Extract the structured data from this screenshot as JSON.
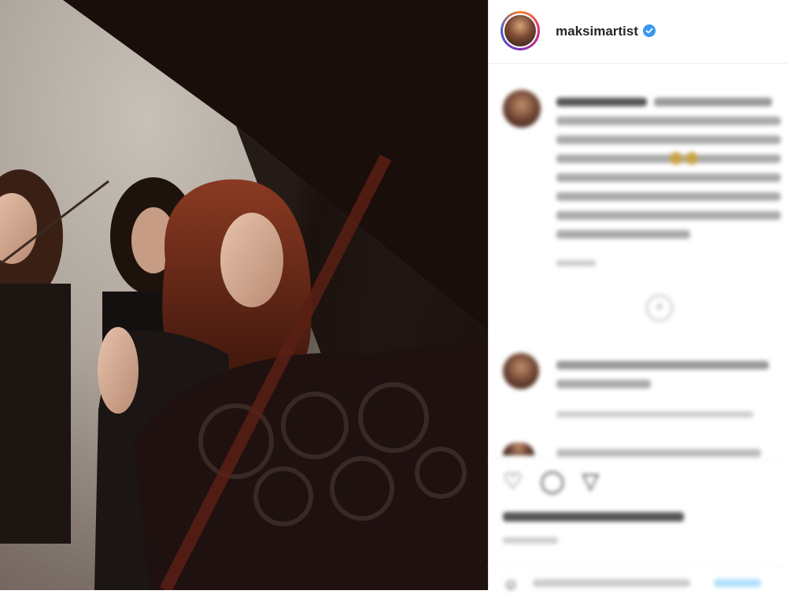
{
  "post": {
    "username": "maksimartist",
    "verified": true
  },
  "icons": {
    "verified": "verified-badge-icon",
    "more": "more-options-icon",
    "like": "heart-icon",
    "comment": "comment-icon",
    "share": "share-icon",
    "load_more": "plus-circle-icon",
    "emoji": "emoji-icon"
  },
  "colors": {
    "verified": "#3897f0",
    "text": "#262626",
    "muted": "#8e8e8e"
  }
}
